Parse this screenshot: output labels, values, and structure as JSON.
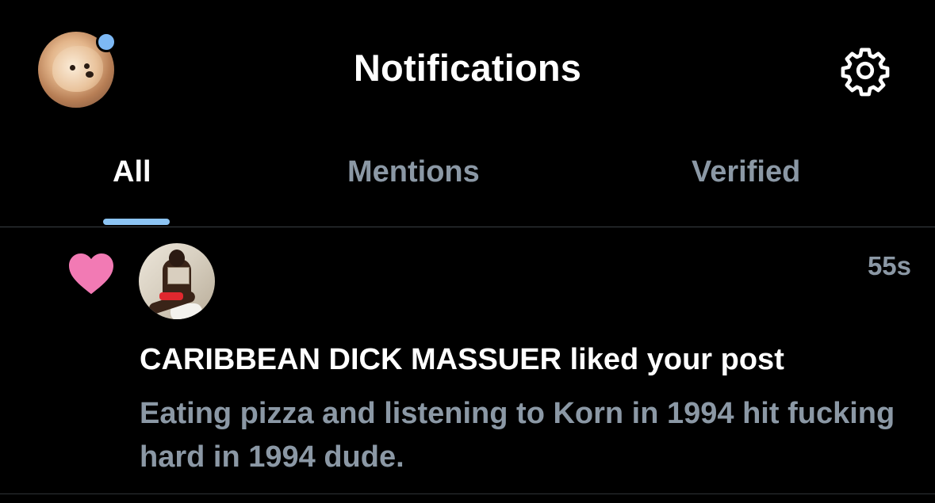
{
  "header": {
    "title": "Notifications",
    "avatar_icon": "puppy-avatar",
    "status_dot_color": "#7db9f5",
    "settings_icon": "gear-icon"
  },
  "tabs": [
    {
      "label": "All",
      "active": true
    },
    {
      "label": "Mentions",
      "active": false
    },
    {
      "label": "Verified",
      "active": false
    }
  ],
  "accent_color": "#8cc4f4",
  "notifications": [
    {
      "type_icon": "heart-icon",
      "type_icon_color": "#f27ab4",
      "user_avatar": "user-avatar",
      "timestamp": "55s",
      "action_text": "CARIBBEAN DICK MASSUER liked your post",
      "post_preview": "Eating pizza and listening to Korn in 1994 hit fucking hard in 1994 dude."
    }
  ]
}
